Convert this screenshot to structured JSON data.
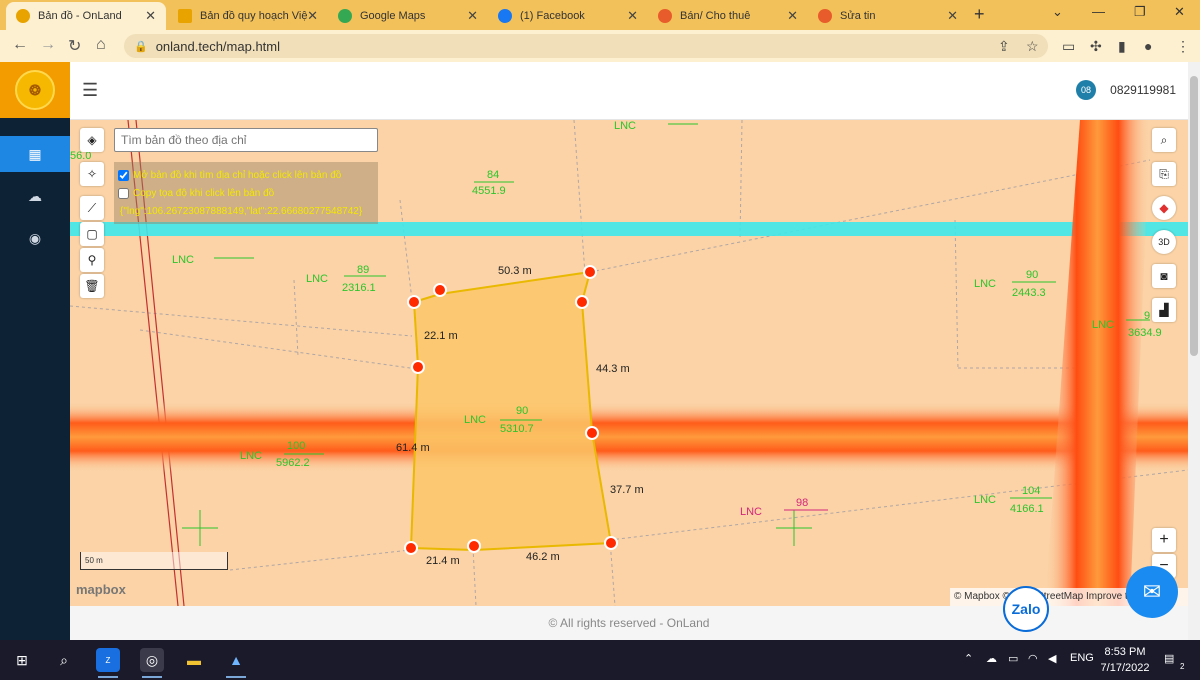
{
  "browser": {
    "tabs": [
      {
        "title": "Bản đồ - OnLand",
        "icon": "onland-icon",
        "color": "#e8a300"
      },
      {
        "title": "Bản đồ quy hoạch Việ",
        "icon": "folder-icon",
        "color": "#e8a300"
      },
      {
        "title": "Google Maps",
        "icon": "google-maps-icon",
        "color": "#34a853"
      },
      {
        "title": "(1) Facebook",
        "icon": "facebook-icon",
        "color": "#1877f2"
      },
      {
        "title": "Bán/ Cho thuê",
        "icon": "house-icon",
        "color": "#e85b2a"
      },
      {
        "title": "Sửa tin",
        "icon": "house-icon",
        "color": "#e85b2a"
      }
    ],
    "new_tab": "+",
    "url": "onland.tech/map.html"
  },
  "header": {
    "badge": "08",
    "phone": "0829119981"
  },
  "map": {
    "search_placeholder": "Tìm bản đồ theo địa chỉ",
    "options": {
      "opt1_label": "Mở bản đồ khi tìm địa chỉ hoặc click lên bản đồ",
      "opt1_checked": true,
      "opt2_label": "Copy tọa độ khi click lên bản đồ",
      "opt2_checked": false,
      "coord_text": "{\"lng\":106.26723087888149,\"lat\":22.66680277548742}"
    },
    "land_labels": {
      "lnc_top": "LNC",
      "lnc_left": "LNC",
      "lnc_89": "LNC",
      "num_89": "89",
      "area_89": "2316.1",
      "num_84": "84",
      "area_84": "4551.9",
      "lnc_90r": "LNC",
      "num_90r": "90",
      "area_90r": "2443.3",
      "lnc_9": "LNC",
      "num_9": "9",
      "area_9": "3634.9",
      "lnc_center": "LNC",
      "num_center": "90",
      "area_center": "5310.7",
      "lnc_100": "LNC",
      "num_100": "100",
      "area_100": "5962.2",
      "lnc_98": "LNC",
      "num_98": "98",
      "lnc_104": "LNC",
      "num_104": "104",
      "area_104": "4166.1",
      "edge_left_value": "56.0"
    },
    "dimensions": {
      "top": "50.3 m",
      "left_upper": "22.1 m",
      "right_upper": "44.3 m",
      "left_lower": "61.4 m",
      "right_lower": "37.7 m",
      "bottom_left": "21.4 m",
      "bottom_right": "46.2 m"
    },
    "scale_label": "50 m",
    "mapbox_logo": "mapbox",
    "attribution": "© Mapbox © OpenStreetMap Improve this map",
    "zoom_in": "+",
    "zoom_out": "−"
  },
  "footer": "© All rights reserved - OnLand",
  "chat": {
    "zalo": "Zalo"
  },
  "taskbar": {
    "language": "ENG",
    "time": "8:53 PM",
    "date": "7/17/2022",
    "notifications": "2"
  },
  "colors": {
    "tab_bar": "#f3c15a",
    "sidebar": "#0d2235",
    "accent": "#1e86e3",
    "map_bg": "#fbd3a6",
    "parcel_fill": "#fbc567",
    "parcel_stroke": "#e9b800",
    "label_green": "#2cc52c",
    "label_magenta": "#d6267b"
  }
}
